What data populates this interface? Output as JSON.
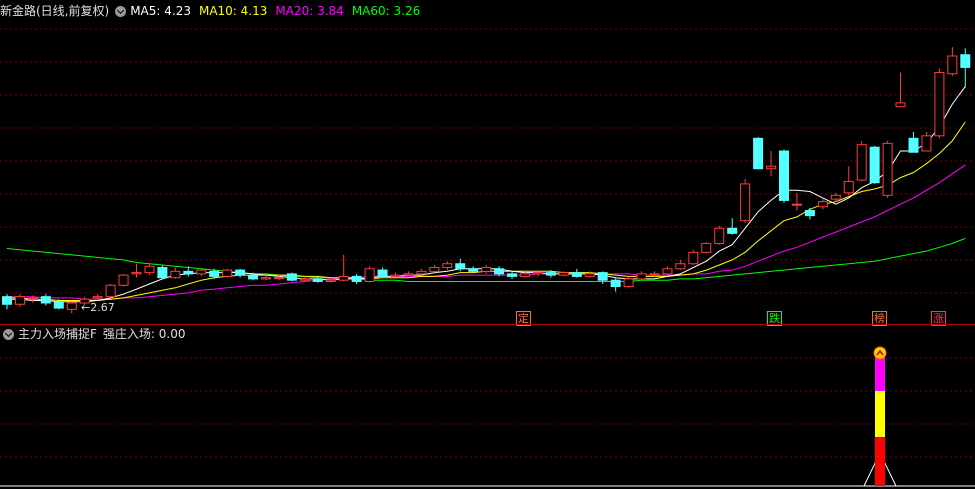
{
  "main_header": {
    "title": "新金路(日线,前复权)",
    "ma": [
      {
        "label": "MA5: 4.23",
        "color": "#ffffff"
      },
      {
        "label": "MA10: 4.13",
        "color": "#ffff00"
      },
      {
        "label": "MA20: 3.84",
        "color": "#ff00ff"
      },
      {
        "label": "MA60: 3.26",
        "color": "#00ff00"
      }
    ]
  },
  "sub_header": {
    "title": "主力入场捕捉F",
    "value_label": "强庄入场: 0.00"
  },
  "annotations": {
    "low_price": "2.67",
    "tags": [
      {
        "text": "定",
        "color": "#ff6a3c"
      },
      {
        "text": "跌",
        "color": "#00ff00"
      },
      {
        "text": "榜",
        "color": "#ff6a3c"
      },
      {
        "text": "涨",
        "color": "#ff3c3c"
      }
    ]
  },
  "colors": {
    "up": "#ff3c3c",
    "down": "#54ffff",
    "grid": "#7a0000",
    "ma5": "#ffffff",
    "ma10": "#ffff00",
    "ma20": "#ff00ff",
    "ma60": "#00ff00"
  },
  "chart_data": {
    "type": "candlestick",
    "ylim": [
      2.6,
      5.0
    ],
    "candles": [
      [
        2.8,
        2.74,
        2.82,
        2.7
      ],
      [
        2.74,
        2.8,
        2.82,
        2.72
      ],
      [
        2.79,
        2.79,
        2.81,
        2.75
      ],
      [
        2.8,
        2.75,
        2.82,
        2.73
      ],
      [
        2.76,
        2.71,
        2.78,
        2.7
      ],
      [
        2.7,
        2.75,
        2.76,
        2.67
      ],
      [
        2.75,
        2.78,
        2.8,
        2.73
      ],
      [
        2.79,
        2.8,
        2.82,
        2.77
      ],
      [
        2.8,
        2.89,
        2.9,
        2.79
      ],
      [
        2.89,
        2.97,
        2.98,
        2.88
      ],
      [
        2.98,
        2.99,
        3.06,
        2.95
      ],
      [
        2.99,
        3.04,
        3.06,
        2.97
      ],
      [
        3.03,
        2.95,
        3.05,
        2.94
      ],
      [
        2.95,
        3.0,
        3.03,
        2.94
      ],
      [
        3.0,
        2.98,
        3.04,
        2.96
      ],
      [
        2.98,
        3.01,
        3.02,
        2.96
      ],
      [
        3.0,
        2.96,
        3.02,
        2.94
      ],
      [
        2.96,
        3.01,
        3.02,
        2.95
      ],
      [
        3.01,
        2.97,
        3.02,
        2.95
      ],
      [
        2.97,
        2.94,
        2.99,
        2.93
      ],
      [
        2.94,
        2.95,
        2.97,
        2.93
      ],
      [
        2.95,
        2.95,
        2.97,
        2.93
      ],
      [
        2.98,
        2.93,
        2.99,
        2.92
      ],
      [
        2.93,
        2.94,
        2.96,
        2.92
      ],
      [
        2.94,
        2.92,
        2.96,
        2.91
      ],
      [
        2.92,
        2.93,
        2.95,
        2.91
      ],
      [
        2.93,
        2.96,
        3.13,
        2.92
      ],
      [
        2.96,
        2.92,
        2.98,
        2.9
      ],
      [
        2.92,
        3.02,
        3.04,
        2.91
      ],
      [
        3.01,
        2.96,
        3.03,
        2.95
      ],
      [
        2.96,
        2.97,
        2.99,
        2.95
      ],
      [
        2.97,
        2.98,
        3.0,
        2.96
      ],
      [
        2.98,
        3.0,
        3.02,
        2.97
      ],
      [
        3.0,
        3.03,
        3.05,
        2.98
      ],
      [
        3.03,
        3.06,
        3.08,
        3.01
      ],
      [
        3.06,
        3.02,
        3.1,
        3.0
      ],
      [
        3.02,
        3.0,
        3.04,
        2.99
      ],
      [
        3.0,
        3.03,
        3.05,
        2.98
      ],
      [
        3.02,
        2.98,
        3.04,
        2.96
      ],
      [
        2.98,
        2.96,
        3.0,
        2.94
      ],
      [
        2.96,
        2.98,
        3.0,
        2.95
      ],
      [
        2.98,
        2.99,
        3.01,
        2.96
      ],
      [
        2.99,
        2.97,
        3.01,
        2.95
      ],
      [
        2.97,
        2.99,
        3.0,
        2.96
      ],
      [
        2.99,
        2.96,
        3.02,
        2.95
      ],
      [
        2.96,
        2.98,
        3.0,
        2.95
      ],
      [
        2.99,
        2.93,
        3.0,
        2.9
      ],
      [
        2.93,
        2.88,
        2.95,
        2.84
      ],
      [
        2.88,
        2.94,
        2.96,
        2.87
      ],
      [
        2.94,
        2.98,
        3.0,
        2.93
      ],
      [
        2.98,
        2.98,
        3.0,
        2.96
      ],
      [
        2.98,
        3.02,
        3.04,
        2.97
      ],
      [
        3.02,
        3.06,
        3.09,
        3.01
      ],
      [
        3.06,
        3.15,
        3.17,
        3.05
      ],
      [
        3.15,
        3.22,
        3.23,
        3.14
      ],
      [
        3.22,
        3.34,
        3.36,
        3.21
      ],
      [
        3.34,
        3.3,
        3.42,
        3.29
      ],
      [
        3.4,
        3.69,
        3.73,
        3.38
      ],
      [
        4.05,
        3.81,
        4.06,
        3.81
      ],
      [
        3.81,
        3.83,
        3.95,
        3.75
      ],
      [
        3.95,
        3.56,
        3.96,
        3.54
      ],
      [
        3.53,
        3.53,
        3.62,
        3.48
      ],
      [
        3.48,
        3.44,
        3.5,
        3.41
      ],
      [
        3.51,
        3.55,
        3.57,
        3.49
      ],
      [
        3.57,
        3.6,
        3.62,
        3.55
      ],
      [
        3.62,
        3.71,
        3.83,
        3.6
      ],
      [
        3.72,
        4.0,
        4.03,
        3.71
      ],
      [
        3.98,
        3.7,
        3.99,
        3.69
      ],
      [
        3.6,
        4.01,
        4.03,
        3.58
      ],
      [
        4.3,
        4.33,
        4.57,
        4.3
      ],
      [
        4.05,
        3.94,
        4.1,
        3.94
      ],
      [
        3.95,
        4.07,
        4.1,
        3.95
      ],
      [
        4.07,
        4.57,
        4.6,
        4.05
      ],
      [
        4.56,
        4.7,
        4.77,
        4.54
      ],
      [
        4.71,
        4.61,
        4.76,
        4.45
      ]
    ],
    "ma5": [
      2.78,
      2.78,
      2.77,
      2.77,
      2.76,
      2.76,
      2.76,
      2.77,
      2.79,
      2.82,
      2.86,
      2.9,
      2.94,
      2.97,
      2.98,
      2.99,
      2.99,
      2.99,
      2.99,
      2.98,
      2.97,
      2.96,
      2.95,
      2.94,
      2.94,
      2.93,
      2.94,
      2.94,
      2.95,
      2.96,
      2.96,
      2.97,
      2.97,
      2.99,
      3.0,
      3.02,
      3.02,
      3.02,
      3.02,
      3.0,
      2.99,
      2.99,
      2.98,
      2.98,
      2.98,
      2.98,
      2.97,
      2.95,
      2.94,
      2.94,
      2.94,
      2.96,
      2.98,
      3.03,
      3.08,
      3.16,
      3.21,
      3.34,
      3.47,
      3.56,
      3.64,
      3.64,
      3.63,
      3.58,
      3.53,
      3.58,
      3.66,
      3.71,
      3.79,
      3.95,
      3.95,
      4.01,
      4.14,
      4.32,
      4.46
    ],
    "ma10": [
      2.79,
      2.79,
      2.78,
      2.78,
      2.77,
      2.77,
      2.77,
      2.77,
      2.78,
      2.79,
      2.81,
      2.83,
      2.85,
      2.87,
      2.9,
      2.93,
      2.95,
      2.96,
      2.97,
      2.97,
      2.97,
      2.97,
      2.97,
      2.96,
      2.96,
      2.95,
      2.95,
      2.95,
      2.94,
      2.95,
      2.95,
      2.95,
      2.96,
      2.96,
      2.97,
      2.99,
      2.99,
      3.0,
      3.0,
      3.0,
      3.0,
      3.0,
      3.0,
      2.99,
      2.99,
      2.99,
      2.98,
      2.97,
      2.96,
      2.96,
      2.96,
      2.96,
      2.97,
      2.98,
      3.01,
      3.05,
      3.09,
      3.15,
      3.24,
      3.32,
      3.4,
      3.43,
      3.49,
      3.53,
      3.55,
      3.59,
      3.63,
      3.65,
      3.68,
      3.74,
      3.78,
      3.85,
      3.93,
      4.03,
      4.18
    ],
    "ma20": [
      2.8,
      2.8,
      2.8,
      2.79,
      2.79,
      2.79,
      2.78,
      2.78,
      2.78,
      2.79,
      2.79,
      2.8,
      2.81,
      2.82,
      2.83,
      2.85,
      2.86,
      2.87,
      2.88,
      2.89,
      2.89,
      2.9,
      2.91,
      2.92,
      2.93,
      2.94,
      2.95,
      2.95,
      2.96,
      2.96,
      2.96,
      2.96,
      2.96,
      2.96,
      2.96,
      2.97,
      2.97,
      2.97,
      2.97,
      2.97,
      2.97,
      2.98,
      2.98,
      2.98,
      2.98,
      2.98,
      2.98,
      2.98,
      2.98,
      2.97,
      2.97,
      2.97,
      2.97,
      2.98,
      2.98,
      3.0,
      3.01,
      3.04,
      3.08,
      3.12,
      3.16,
      3.19,
      3.23,
      3.27,
      3.31,
      3.35,
      3.39,
      3.43,
      3.48,
      3.53,
      3.58,
      3.64,
      3.7,
      3.77,
      3.84
    ],
    "ma60": [
      3.18,
      3.17,
      3.16,
      3.15,
      3.14,
      3.13,
      3.12,
      3.11,
      3.1,
      3.09,
      3.07,
      3.06,
      3.05,
      3.04,
      3.03,
      3.02,
      3.01,
      3.0,
      2.99,
      2.98,
      2.98,
      2.97,
      2.96,
      2.96,
      2.95,
      2.95,
      2.94,
      2.94,
      2.93,
      2.93,
      2.93,
      2.92,
      2.92,
      2.92,
      2.92,
      2.92,
      2.92,
      2.92,
      2.92,
      2.92,
      2.92,
      2.92,
      2.92,
      2.92,
      2.92,
      2.92,
      2.92,
      2.92,
      2.92,
      2.93,
      2.93,
      2.93,
      2.94,
      2.94,
      2.95,
      2.96,
      2.97,
      2.98,
      2.99,
      3.0,
      3.01,
      3.02,
      3.03,
      3.04,
      3.05,
      3.06,
      3.07,
      3.08,
      3.1,
      3.12,
      3.14,
      3.16,
      3.19,
      3.22,
      3.26
    ]
  }
}
